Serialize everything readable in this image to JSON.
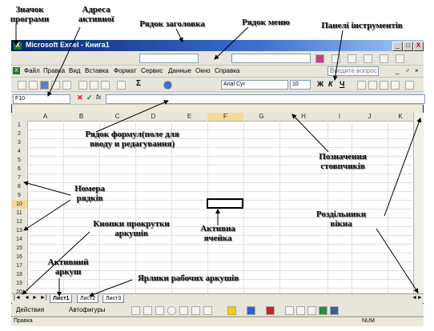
{
  "annotations": {
    "app_icon": "Значок\nпрограми",
    "active_address": "Адреса\nактивної",
    "title_row": "Рядок заголовка",
    "menu_row": "Рядок меню",
    "toolbars": "Панелі інструментів",
    "formula_row": "Рядок формул(поле для\nвводу и редагування)",
    "column_labels": "Позначення\nстовпчиків",
    "row_numbers": "Номера\nрядків",
    "scroll_buttons": "Кнопки прокрутки\nаркушів",
    "active_cell": "Активна\nячейка",
    "window_splitters": "Роздільники\nвікна",
    "active_sheet": "Активний\nаркуш",
    "sheet_tabs": "Ярлики рабочих аркушів"
  },
  "window": {
    "title": "Microsoft Excel - Книга1",
    "buttons": [
      "_",
      "□",
      "X"
    ],
    "doc_buttons": [
      "_",
      "♂",
      "×"
    ]
  },
  "menu": [
    "Файл",
    "Правка",
    "Вид",
    "Вставка",
    "Формат",
    "Сервис",
    "Данные",
    "Окно",
    "Справка"
  ],
  "help_placeholder": "Введите вопрос",
  "toolbar": {
    "font": "Arial Cyr",
    "size": "10",
    "bold": "Ж",
    "italic": "К",
    "underline": "Ч",
    "sum": "Σ"
  },
  "formula_bar": {
    "name_box": "F10",
    "cancel": "✕",
    "enter": "✓",
    "fx": "fx"
  },
  "columns": [
    "A",
    "B",
    "C",
    "D",
    "E",
    "F",
    "G",
    "H",
    "I",
    "J",
    "K"
  ],
  "rows": [
    "1",
    "2",
    "3",
    "4",
    "5",
    "6",
    "7",
    "8",
    "9",
    "10",
    "11",
    "12",
    "13",
    "14",
    "15",
    "16",
    "17",
    "18",
    "19",
    "20"
  ],
  "sheets": [
    "Лист1",
    "Лист2",
    "Лист3"
  ],
  "drawing_bar": {
    "actions": "Действия",
    "autoshapes": "Автофигуры"
  },
  "status": {
    "left": "Правка",
    "num": "NUM"
  }
}
